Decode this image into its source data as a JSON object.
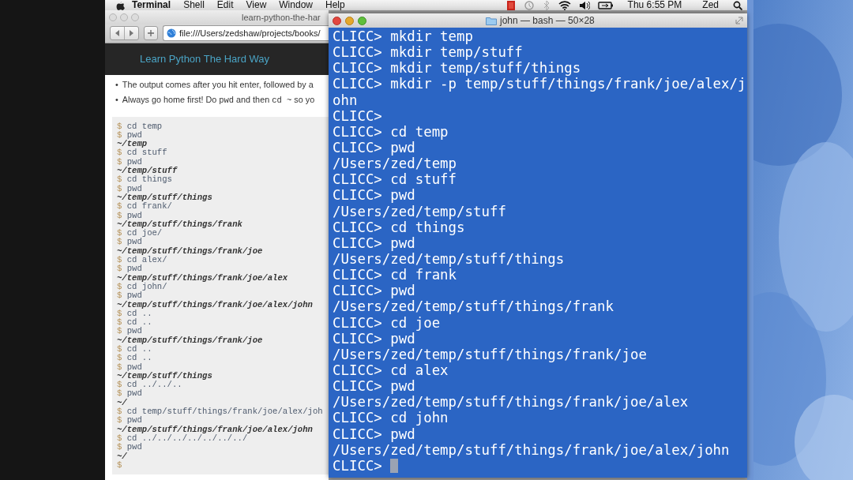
{
  "menu_bar": {
    "app": "Terminal",
    "items": [
      "Shell",
      "Edit",
      "View",
      "Window",
      "Help"
    ],
    "clock": "Thu 6:55 PM",
    "user": "Zed"
  },
  "browser": {
    "title": "learn-python-the-har",
    "url": "file:///Users/zedshaw/projects/books/",
    "header_link": "Learn Python The Hard Way",
    "bullets": [
      {
        "marker": "•",
        "segments": [
          {
            "kind": "text",
            "text": "The output comes after you hit enter, followed by a"
          }
        ]
      },
      {
        "marker": "•",
        "segments": [
          {
            "kind": "text",
            "text": "Always go home first! Do "
          },
          {
            "kind": "code",
            "text": "pwd"
          },
          {
            "kind": "text",
            "text": " and then "
          },
          {
            "kind": "code",
            "text": "cd ~"
          },
          {
            "kind": "text",
            "text": " so yo"
          }
        ]
      }
    ],
    "code_lines": [
      {
        "kind": "command",
        "prompt": "$",
        "text": "cd temp"
      },
      {
        "kind": "command",
        "prompt": "$",
        "text": "pwd"
      },
      {
        "kind": "output",
        "text": "~/temp"
      },
      {
        "kind": "command",
        "prompt": "$",
        "text": "cd stuff"
      },
      {
        "kind": "command",
        "prompt": "$",
        "text": "pwd"
      },
      {
        "kind": "output",
        "text": "~/temp/stuff"
      },
      {
        "kind": "command",
        "prompt": "$",
        "text": "cd things"
      },
      {
        "kind": "command",
        "prompt": "$",
        "text": "pwd"
      },
      {
        "kind": "output",
        "text": "~/temp/stuff/things"
      },
      {
        "kind": "command",
        "prompt": "$",
        "text": "cd frank/"
      },
      {
        "kind": "command",
        "prompt": "$",
        "text": "pwd"
      },
      {
        "kind": "output",
        "text": "~/temp/stuff/things/frank"
      },
      {
        "kind": "command",
        "prompt": "$",
        "text": "cd joe/"
      },
      {
        "kind": "command",
        "prompt": "$",
        "text": "pwd"
      },
      {
        "kind": "output",
        "text": "~/temp/stuff/things/frank/joe"
      },
      {
        "kind": "command",
        "prompt": "$",
        "text": "cd alex/"
      },
      {
        "kind": "command",
        "prompt": "$",
        "text": "pwd"
      },
      {
        "kind": "output",
        "text": "~/temp/stuff/things/frank/joe/alex"
      },
      {
        "kind": "command",
        "prompt": "$",
        "text": "cd john/"
      },
      {
        "kind": "command",
        "prompt": "$",
        "text": "pwd"
      },
      {
        "kind": "output",
        "text": "~/temp/stuff/things/frank/joe/alex/john"
      },
      {
        "kind": "command",
        "prompt": "$",
        "text": "cd .."
      },
      {
        "kind": "command",
        "prompt": "$",
        "text": "cd .."
      },
      {
        "kind": "command",
        "prompt": "$",
        "text": "pwd"
      },
      {
        "kind": "output",
        "text": "~/temp/stuff/things/frank/joe"
      },
      {
        "kind": "command",
        "prompt": "$",
        "text": "cd .."
      },
      {
        "kind": "command",
        "prompt": "$",
        "text": "cd .."
      },
      {
        "kind": "command",
        "prompt": "$",
        "text": "pwd"
      },
      {
        "kind": "output",
        "text": "~/temp/stuff/things"
      },
      {
        "kind": "command",
        "prompt": "$",
        "text": "cd ../../.."
      },
      {
        "kind": "command",
        "prompt": "$",
        "text": "pwd"
      },
      {
        "kind": "output",
        "text": "~/"
      },
      {
        "kind": "command",
        "prompt": "$",
        "text": "cd temp/stuff/things/frank/joe/alex/joh"
      },
      {
        "kind": "command",
        "prompt": "$",
        "text": "pwd"
      },
      {
        "kind": "output",
        "text": "~/temp/stuff/things/frank/joe/alex/john"
      },
      {
        "kind": "command",
        "prompt": "$",
        "text": "cd ../../../../../../../"
      },
      {
        "kind": "command",
        "prompt": "$",
        "text": "pwd"
      },
      {
        "kind": "output",
        "text": "~/"
      },
      {
        "kind": "prompt",
        "prompt": "$"
      }
    ]
  },
  "terminal": {
    "title": "john — bash — 50×28",
    "cursor": true,
    "lines": [
      "CLICC> mkdir temp",
      "CLICC> mkdir temp/stuff",
      "CLICC> mkdir temp/stuff/things",
      "CLICC> mkdir -p temp/stuff/things/frank/joe/alex/j",
      "ohn",
      "CLICC>",
      "CLICC> cd temp",
      "CLICC> pwd",
      "/Users/zed/temp",
      "CLICC> cd stuff",
      "CLICC> pwd",
      "/Users/zed/temp/stuff",
      "CLICC> cd things",
      "CLICC> pwd",
      "/Users/zed/temp/stuff/things",
      "CLICC> cd frank",
      "CLICC> pwd",
      "/Users/zed/temp/stuff/things/frank",
      "CLICC> cd joe",
      "CLICC> pwd",
      "/Users/zed/temp/stuff/things/frank/joe",
      "CLICC> cd alex",
      "CLICC> pwd",
      "/Users/zed/temp/stuff/things/frank/joe/alex",
      "CLICC> cd john",
      "CLICC> pwd",
      "/Users/zed/temp/stuff/things/frank/joe/alex/john",
      "CLICC>"
    ]
  }
}
